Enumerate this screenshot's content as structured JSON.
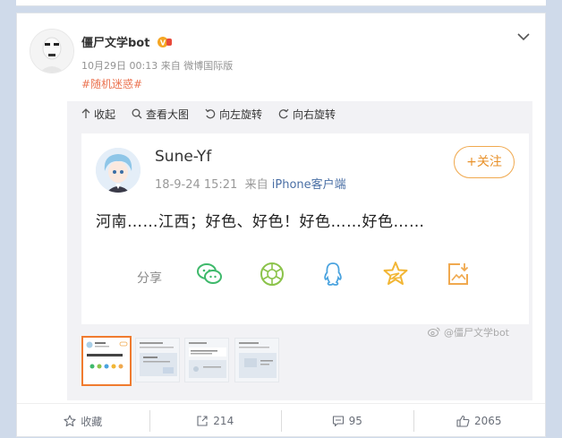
{
  "post": {
    "author": "僵尸文学bot",
    "time": "10月29日 00:13",
    "via": "来自 微博国际版",
    "hashtag": "#随机迷惑#"
  },
  "toolbar": [
    {
      "label": "收起",
      "icon": "collapse-arrow-icon"
    },
    {
      "label": "查看大图",
      "icon": "magnifier-icon"
    },
    {
      "label": "向左旋转",
      "icon": "rotate-left-icon"
    },
    {
      "label": "向右旋转",
      "icon": "rotate-right-icon"
    }
  ],
  "screenshot": {
    "name": "Sune-Yf",
    "date": "18-9-24 15:21",
    "source_prefix": "来自",
    "source": "iPhone客户端",
    "follow_label": "+关注",
    "text": "河南……江西；好色、好色！好色……好色……",
    "share_label": "分享",
    "share_icons": [
      "wechat-icon",
      "moments-icon",
      "qq-icon",
      "qzone-icon",
      "save-image-icon"
    ],
    "share_colors": {
      "wechat": "#3fb96b",
      "moments": "#8bc34a",
      "qq": "#4aa3df",
      "qzone": "#f2b635",
      "save": "#f0a94f"
    }
  },
  "watermark": "@僵尸文学bot",
  "footer": {
    "favorite": "收藏",
    "repost": "214",
    "comment": "95",
    "like": "2065"
  },
  "colors": {
    "accent": "#eb7350",
    "follow": "#e8912a",
    "background": "#cfdaea"
  }
}
